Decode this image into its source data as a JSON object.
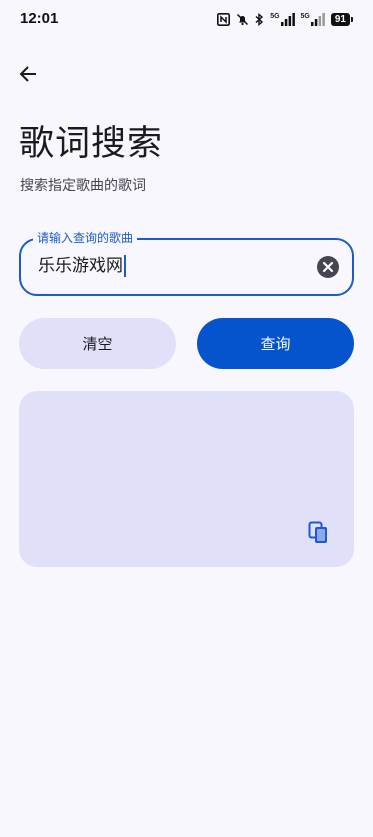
{
  "status_bar": {
    "time": "12:01",
    "network_1": "5G",
    "network_2": "5G",
    "battery": "91"
  },
  "header": {
    "back_icon": "arrow-back-icon",
    "title": "歌词搜索",
    "subtitle": "搜索指定歌曲的歌词"
  },
  "search": {
    "label": "请输入查询的歌曲",
    "value": "乐乐游戏网",
    "clear_icon": "clear-circle-icon"
  },
  "actions": {
    "clear_label": "清空",
    "query_label": "查询"
  },
  "result": {
    "text": "",
    "copy_icon": "copy-icon"
  },
  "colors": {
    "background": "#F8F7FE",
    "primary": "#0653CE",
    "outline": "#1E5BC6",
    "tonal": "#E1E0F9"
  }
}
